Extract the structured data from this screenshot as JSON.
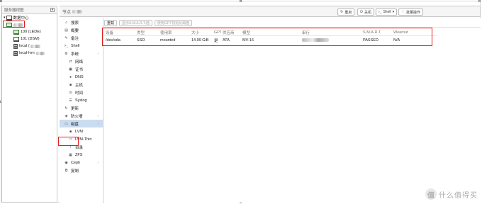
{
  "tree": {
    "header": "服务器视图",
    "items": [
      {
        "label": "数据中心",
        "indent": 0,
        "icon": "datacenter-icon"
      },
      {
        "label": "",
        "indent": 1,
        "icon": "node-icon",
        "blurred": true
      },
      {
        "label": "100 (LEDE)",
        "indent": 2,
        "icon": "vm-icon"
      },
      {
        "label": "101 (DSM)",
        "indent": 2,
        "icon": "vm-icon"
      },
      {
        "label": "local (",
        "indent": 2,
        "icon": "storage-icon",
        "suffix_blur": true
      },
      {
        "label": "local-lvm",
        "indent": 2,
        "icon": "storage-icon",
        "suffix_blur": true
      }
    ]
  },
  "header": {
    "title": "节点",
    "buttons": {
      "reboot": "重启",
      "shutdown": "关机",
      "shell": "Shell",
      "bulk": "批量操作"
    }
  },
  "nav": {
    "items": [
      {
        "label": "搜索",
        "icon": "search-icon",
        "sub": false
      },
      {
        "label": "概要",
        "icon": "summary-icon",
        "sub": false
      },
      {
        "label": "备注",
        "icon": "notes-icon",
        "sub": false
      },
      {
        "label": "Shell",
        "icon": "terminal-icon",
        "sub": false
      },
      {
        "label": "系统",
        "icon": "gear-icon",
        "sub": false,
        "chevron": true
      },
      {
        "label": "网络",
        "icon": "network-icon",
        "sub": true
      },
      {
        "label": "证书",
        "icon": "certificate-icon",
        "sub": true
      },
      {
        "label": "DNS",
        "icon": "globe-icon",
        "sub": true
      },
      {
        "label": "主机",
        "icon": "host-icon",
        "sub": true
      },
      {
        "label": "时间",
        "icon": "clock-icon",
        "sub": true
      },
      {
        "label": "Syslog",
        "icon": "list-icon",
        "sub": true
      },
      {
        "label": "更新",
        "icon": "refresh-icon",
        "sub": false
      },
      {
        "label": "防火墙",
        "icon": "shield-icon",
        "sub": false,
        "chevron": true
      },
      {
        "label": "磁盘",
        "icon": "disk-icon",
        "sub": false,
        "active": true,
        "chevron": true
      },
      {
        "label": "LVM",
        "icon": "square-icon",
        "sub": true
      },
      {
        "label": "LVM-Thin",
        "icon": "square-outline-icon",
        "sub": true
      },
      {
        "label": "目录",
        "icon": "folder-icon",
        "sub": true
      },
      {
        "label": "ZFS",
        "icon": "grid-icon",
        "sub": true
      },
      {
        "label": "Ceph",
        "icon": "ceph-icon",
        "sub": false,
        "chevron": true
      },
      {
        "label": "复制",
        "icon": "copy-icon",
        "sub": false
      }
    ]
  },
  "toolbar": {
    "reload": "重载",
    "smart": "显示S.M.A.R.T.值",
    "init_gpt": "使用GPT初始化磁盘"
  },
  "disk_table": {
    "columns": [
      "设备",
      "类型",
      "使用率",
      "大小",
      "GPT",
      "供应商",
      "模型",
      "串行",
      "S.M.A.R.T.",
      "Wearout"
    ],
    "rows": [
      {
        "device": "/dev/sda",
        "type": "SSD",
        "usage": "mounted",
        "size": "14.99 GiB",
        "gpt": "是",
        "vendor": "ATA",
        "model": "MV-16",
        "serial": "",
        "smart": "PASSED",
        "wearout": "N/A"
      }
    ]
  },
  "watermark": {
    "text": "什么值得买",
    "logo": "值"
  }
}
